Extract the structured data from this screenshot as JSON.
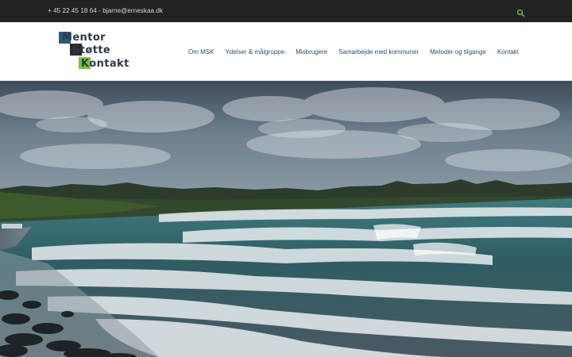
{
  "topbar": {
    "contact_text": "+ 45 22 45 18 64 - bjarne@erneskaa.dk",
    "search_icon": "search-icon",
    "accent_color": "#7fbe43",
    "background_color": "#222222"
  },
  "logo": {
    "line1": "Mentor",
    "line2": "Støtte",
    "line3": "Kontakt",
    "colors": [
      "#2f5a74",
      "#2a2a2a",
      "#7fbe43"
    ]
  },
  "nav": {
    "items": [
      {
        "label": "Om MSK"
      },
      {
        "label": "Ydelser & målgruppe"
      },
      {
        "label": "Misbrugere"
      },
      {
        "label": "Samarbejde med kommuner"
      },
      {
        "label": "Metoder og tilgange"
      },
      {
        "label": "Kontakt"
      }
    ],
    "link_color": "#2d4f6a"
  },
  "hero": {
    "image_subject": "beach-waves-photo"
  }
}
